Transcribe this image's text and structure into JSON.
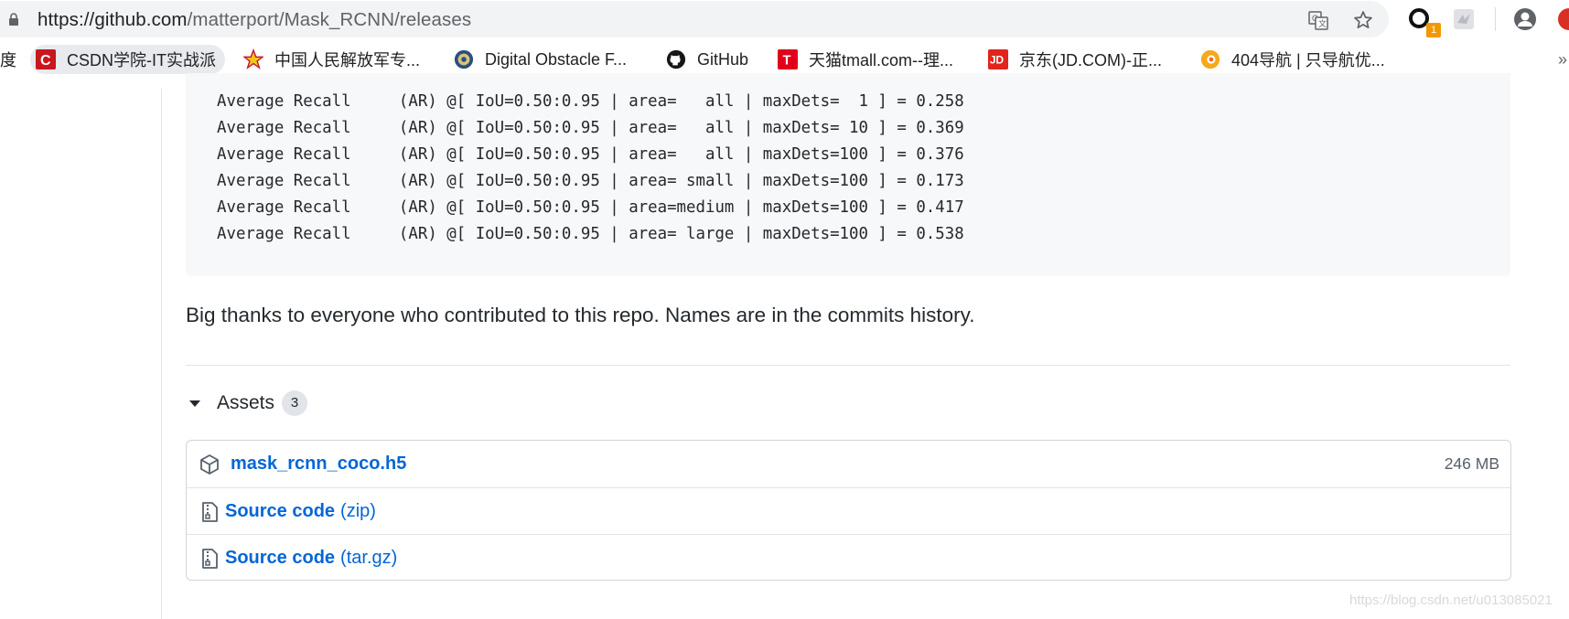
{
  "browser": {
    "url_host": "https://github.com",
    "url_path": "/matterport/Mask_RCNN/releases",
    "extension_badge": "1"
  },
  "bookmarks": [
    {
      "label": "度",
      "icon": "baidu-icon"
    },
    {
      "label": "CSDN学院-IT实战派",
      "icon": "csdn-icon"
    },
    {
      "label": "中国人民解放军专...",
      "icon": "star-emblem-icon"
    },
    {
      "label": "Digital Obstacle F...",
      "icon": "seal-icon"
    },
    {
      "label": "GitHub",
      "icon": "github-icon"
    },
    {
      "label": "天猫tmall.com--理...",
      "icon": "tmall-icon"
    },
    {
      "label": "京东(JD.COM)-正...",
      "icon": "jd-icon"
    },
    {
      "label": "404导航 | 只导航优...",
      "icon": "404-nav-icon"
    },
    {
      "label": "»",
      "icon": "more-bookmarks"
    }
  ],
  "code_lines": [
    "Average Recall     (AR) @[ IoU=0.50:0.95 | area=   all | maxDets=  1 ] = 0.258",
    "Average Recall     (AR) @[ IoU=0.50:0.95 | area=   all | maxDets= 10 ] = 0.369",
    "Average Recall     (AR) @[ IoU=0.50:0.95 | area=   all | maxDets=100 ] = 0.376",
    "Average Recall     (AR) @[ IoU=0.50:0.95 | area= small | maxDets=100 ] = 0.173",
    "Average Recall     (AR) @[ IoU=0.50:0.95 | area=medium | maxDets=100 ] = 0.417",
    "Average Recall     (AR) @[ IoU=0.50:0.95 | area= large | maxDets=100 ] = 0.538"
  ],
  "thanks_text": "Big thanks to everyone who contributed to this repo. Names are in the commits history.",
  "assets": {
    "label": "Assets",
    "count": "3",
    "items": [
      {
        "name": "mask_rcnn_coco.h5",
        "suffix": "",
        "size": "246 MB",
        "icon": "package-icon"
      },
      {
        "name": "Source code",
        "suffix": "(zip)",
        "size": "",
        "icon": "file-zip-icon"
      },
      {
        "name": "Source code",
        "suffix": "(tar.gz)",
        "size": "",
        "icon": "file-zip-icon"
      }
    ]
  },
  "watermark": "https://blog.csdn.net/u013085021",
  "colors": {
    "link": "#0366d6",
    "text": "#24292e",
    "code_bg": "#f6f8fa"
  }
}
